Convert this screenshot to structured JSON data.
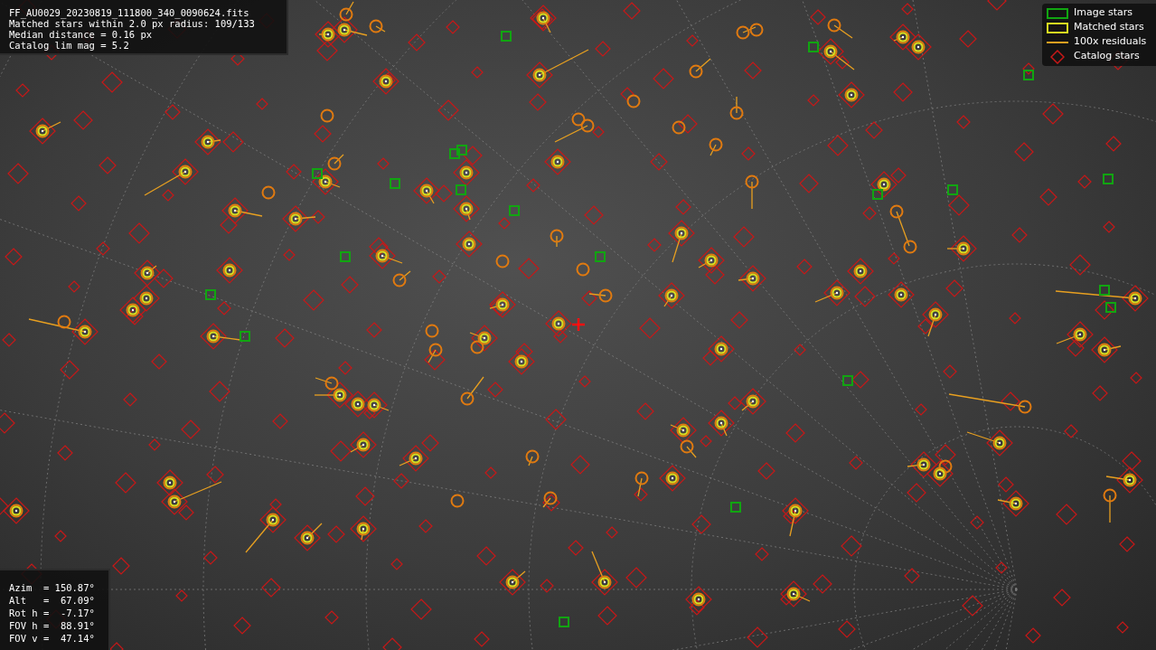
{
  "header_info": [
    "FF_AU0029_20230819_111800_340_0090624.fits",
    "Matched stars within 2.0 px radius: 109/133",
    "Median distance = 0.16 px",
    "Catalog lim mag = 5.2"
  ],
  "legend": [
    {
      "kind": "image",
      "label": "Image stars"
    },
    {
      "kind": "matched",
      "label": "Matched stars"
    },
    {
      "kind": "residual",
      "label": "100x residuals"
    },
    {
      "kind": "catalog",
      "label": "Catalog stars"
    }
  ],
  "pointing_info": [
    "Azim  = 150.87°",
    "Alt   =  67.09°",
    "Rot h =  -7.17°",
    "FOV h =  88.91°",
    "FOV v =  47.14°"
  ]
}
